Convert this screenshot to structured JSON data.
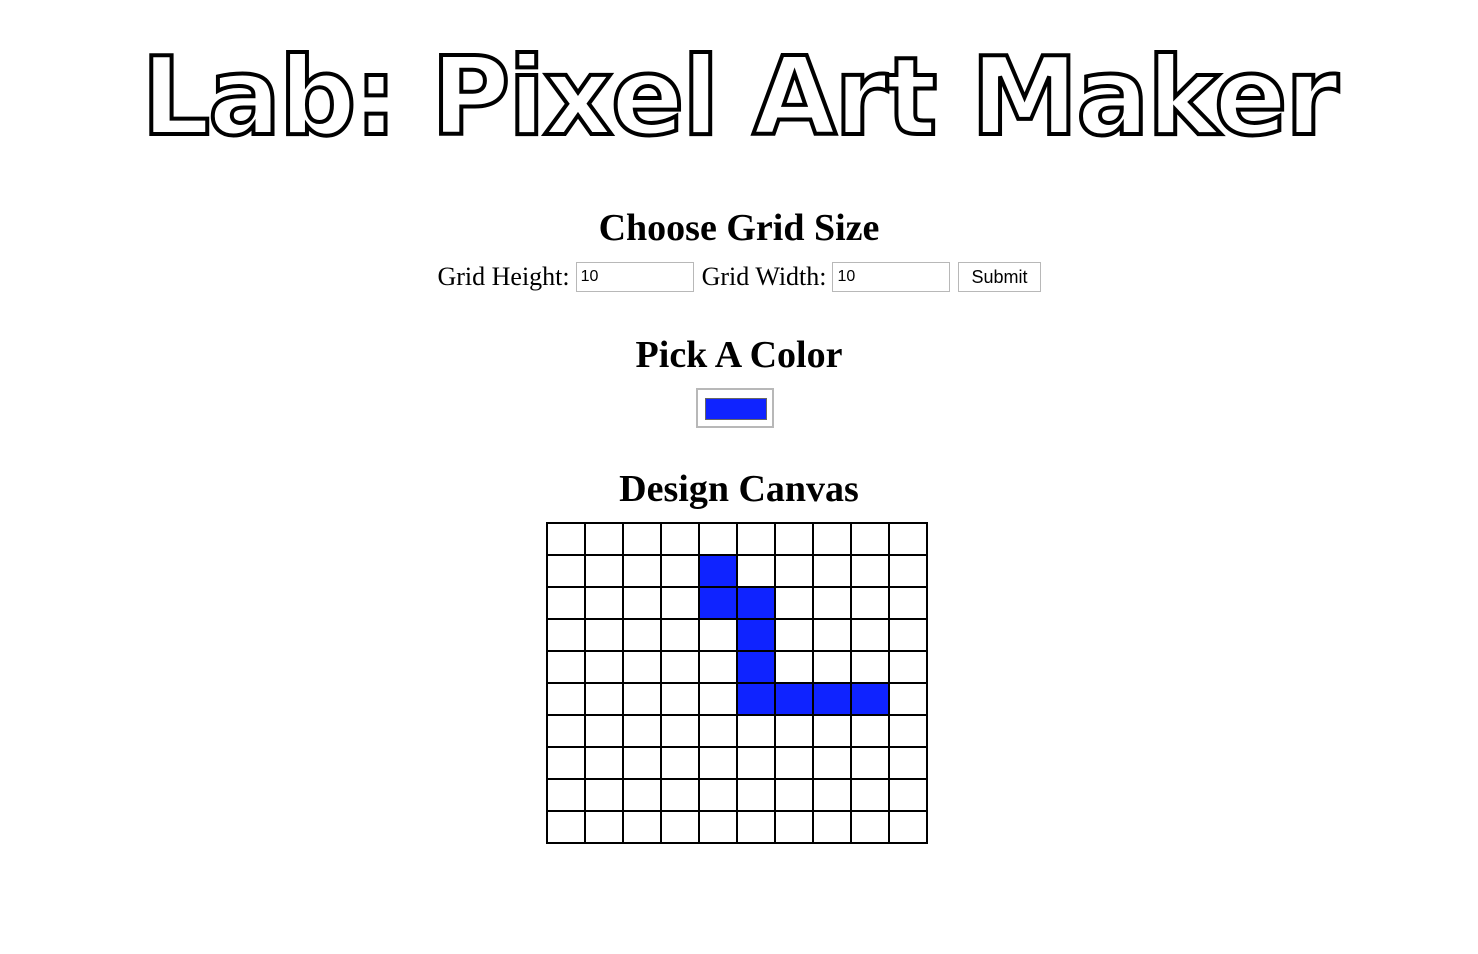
{
  "page": {
    "title": "Lab: Pixel Art Maker"
  },
  "grid_size": {
    "heading": "Choose Grid Size",
    "height_label": "Grid Height:",
    "height_value": "10",
    "width_label": "Grid Width:",
    "width_value": "10",
    "submit_label": "Submit"
  },
  "color": {
    "heading": "Pick A Color",
    "selected": "#0f23ff"
  },
  "canvas": {
    "heading": "Design Canvas",
    "rows": 10,
    "cols": 10,
    "filled_color": "#0f23ff",
    "filled_cells": [
      [
        1,
        4
      ],
      [
        2,
        4
      ],
      [
        2,
        5
      ],
      [
        3,
        5
      ],
      [
        4,
        5
      ],
      [
        5,
        5
      ],
      [
        5,
        6
      ],
      [
        5,
        7
      ],
      [
        5,
        8
      ]
    ]
  }
}
